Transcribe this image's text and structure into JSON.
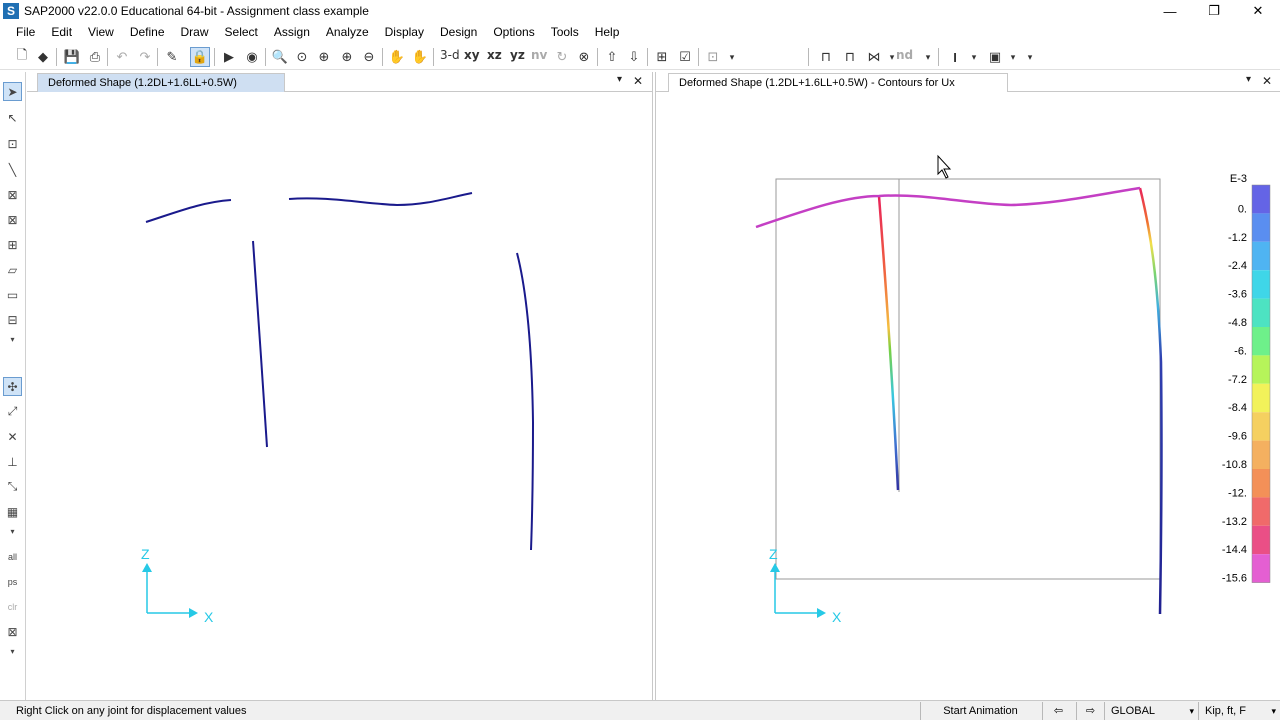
{
  "window": {
    "app_icon": "S",
    "title": "SAP2000 v22.0.0 Educational 64-bit - Assignment class example",
    "minimize": "—",
    "maximize": "❐",
    "close": "✕"
  },
  "menu": [
    "File",
    "Edit",
    "View",
    "Define",
    "Draw",
    "Select",
    "Assign",
    "Analyze",
    "Display",
    "Design",
    "Options",
    "Tools",
    "Help"
  ],
  "toolbar": {
    "view_3d": "3-d",
    "view_xy": "xy",
    "view_xz": "xz",
    "view_yz": "yz",
    "view_nv": "nv",
    "view_nd": "nd"
  },
  "panels": {
    "left": {
      "tab_title": "Deformed Shape (1.2DL+1.6LL+0.5W)",
      "axis_z": "Z",
      "axis_x": "X"
    },
    "right": {
      "tab_title": "Deformed Shape (1.2DL+1.6LL+0.5W) - Contours for Ux",
      "axis_z": "Z",
      "axis_x": "X"
    },
    "tab_dropdown": "▾",
    "tab_close": "✕"
  },
  "legend": {
    "exponent": "E-3",
    "values": [
      "0.",
      "-1.2",
      "-2.4",
      "-3.6",
      "-4.8",
      "-6.",
      "-7.2",
      "-8.4",
      "-9.6",
      "-10.8",
      "-12.",
      "-13.2",
      "-14.4",
      "-15.6"
    ],
    "colors": [
      "#6464e6",
      "#5a8ef0",
      "#4fb4f2",
      "#3fd6e8",
      "#4de3c2",
      "#6ef08a",
      "#b6f45a",
      "#f2f25a",
      "#f5d060",
      "#f4b060",
      "#f39058",
      "#f06a6a",
      "#ea4f86",
      "#e45fd2"
    ]
  },
  "colors": {
    "deformed_line": "#1a1a8c",
    "axis": "#26c9e6",
    "beam_contour": "#c43fc4"
  },
  "status": {
    "hint": "Right Click on any joint for displacement values",
    "start_animation": "Start Animation",
    "coord_system": "GLOBAL",
    "units": "Kip, ft, F"
  }
}
